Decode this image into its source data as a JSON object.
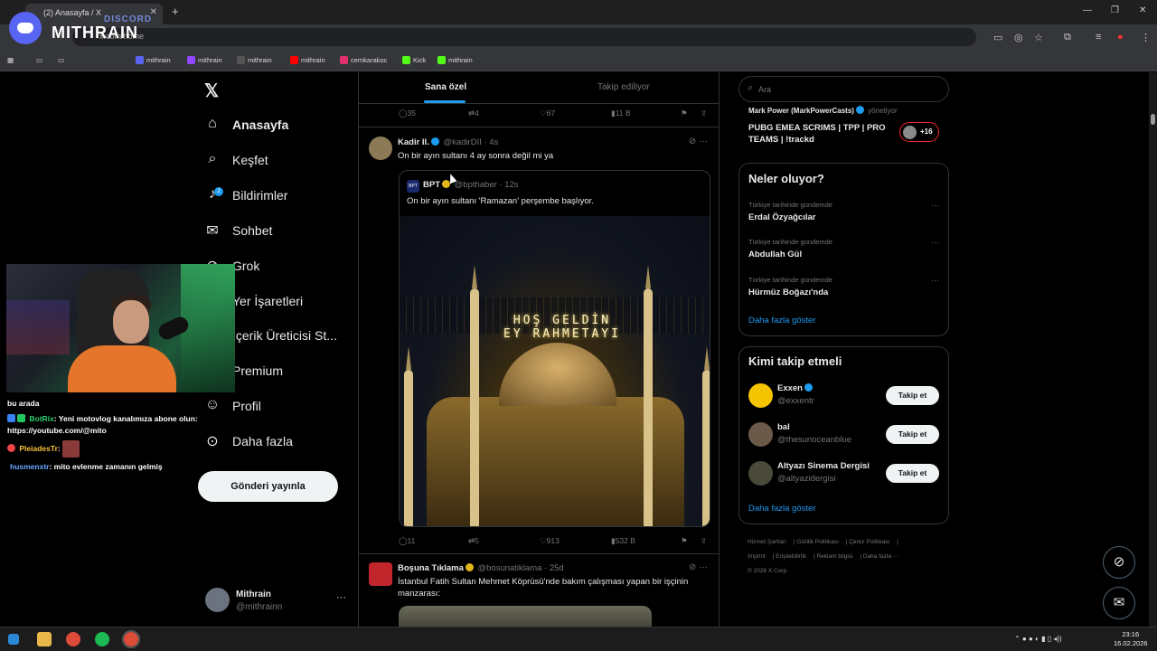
{
  "browser": {
    "tab_title": "(2) Anasayfa / X",
    "url": "x.com/home",
    "bookmarks": [
      {
        "label": "mithrain",
        "color": "#5865f2"
      },
      {
        "label": "mithrain",
        "color": "#9146ff"
      },
      {
        "label": "mithrain",
        "color": "#222222"
      },
      {
        "label": "mithrain",
        "color": "#ff0000"
      },
      {
        "label": "cemkarakoc",
        "color": "#e1306c"
      },
      {
        "label": "Kick",
        "color": "#53fc18"
      },
      {
        "label": "mithrain",
        "color": "#53fc18"
      }
    ]
  },
  "overlay": {
    "discord_label": "DISCORD",
    "channel_name": "MITHRAIN"
  },
  "chat": {
    "line0": "bu arada",
    "line1_user": "BotRix",
    "line1_text": ": Yeni motovlog kanalımıza abone olun: https://youtube.com/@mito",
    "line2_user": "PleiadesTr",
    "line2_text": ":",
    "line3_user": "husmenxtr",
    "line3_text": ": mito evlenme zamanın gelmiş"
  },
  "nav": {
    "logo": "𝕏",
    "items": [
      {
        "label": "Anasayfa",
        "icon": "home-icon"
      },
      {
        "label": "Keşfet",
        "icon": "search-icon"
      },
      {
        "label": "Bildirimler",
        "icon": "bell-icon"
      },
      {
        "label": "Sohbet",
        "icon": "mail-icon"
      },
      {
        "label": "Grok",
        "icon": "grok-icon"
      },
      {
        "label": "Yer İşaretleri",
        "icon": "bookmark-icon"
      },
      {
        "label": "İçerik Üreticisi St...",
        "icon": "creator-icon"
      },
      {
        "label": "Premium",
        "icon": "premium-icon"
      },
      {
        "label": "Profil",
        "icon": "user-icon"
      },
      {
        "label": "Daha fazla",
        "icon": "more-circle-icon"
      }
    ],
    "notification_count": "2",
    "post_button": "Gönderi yayınla"
  },
  "profile": {
    "name": "Mithrain",
    "handle": "@mithrainn",
    "more": "···"
  },
  "feed": {
    "tabs": [
      "Sana özel",
      "Takip ediliyor"
    ],
    "prev_post_actions": {
      "replies": "35",
      "reposts": "4",
      "likes": "67",
      "views": "11 B"
    },
    "post1": {
      "name": "Kadir II.",
      "meta": "@kadirDII · 4s",
      "text": "On bir ayın sultanı 4 ay sonra değil mi ya",
      "quote": {
        "avatar_text": "BPT",
        "name": "BPT",
        "meta": "@bpthaber · 12s",
        "text": "On bir ayın sultanı 'Ramazan' perşembe başlıyor.",
        "mahya_line1": "HOŞ GELDİN",
        "mahya_line2": "EY RAHMETAYI"
      },
      "actions": {
        "replies": "11",
        "reposts": "5",
        "likes": "913",
        "views": "532 B"
      }
    },
    "post2": {
      "name": "Boşuna Tıklama",
      "meta": "@bosunatiklama · 25d",
      "text": "İstanbul Fatih Sultan Mehmet Köprüsü'nde bakım çalışması yapan bir işçinin manzarası:"
    }
  },
  "sidebar": {
    "search_placeholder": "Ara",
    "space": {
      "host": "Mark Power (MarkPowerCasts)",
      "host_role": "yönetiyor",
      "title": "PUBG EMEA SCRIMS | TPP | PRO TEAMS | !trackd",
      "listeners": "+16"
    },
    "trends": {
      "title": "Neler oluyor?",
      "items": [
        {
          "context": "Türkiye tarihinde gündemde",
          "name": "Erdal Özyağcılar"
        },
        {
          "context": "Türkiye tarihinde gündemde",
          "name": "Abdullah Gül"
        },
        {
          "context": "Türkiye tarihinde gündemde",
          "name": "Hürmüz Boğazı'nda"
        }
      ],
      "show_more": "Daha fazla göster"
    },
    "who_to_follow": {
      "title": "Kimi takip etmeli",
      "items": [
        {
          "name": "Exxen",
          "handle": "@exxentr",
          "button": "Takip et"
        },
        {
          "name": "bal",
          "handle": "@thesunoceanblue",
          "button": "Takip et"
        },
        {
          "name": "Altyazı Sinema Dergisi",
          "handle": "@altyazidergisi",
          "button": "Takip et"
        }
      ],
      "show_more": "Daha fazla göster"
    },
    "footer": {
      "links": [
        "Hizmet Şartları",
        "Gizlilik Politikası",
        "Çerez Politikası",
        "Imprint",
        "Erişilebilirlik",
        "Reklam bilgisi",
        "Daha fazla ···"
      ],
      "copyright": "© 2026 X Corp."
    }
  },
  "taskbar": {
    "time": "23:16",
    "date": "16.02.2026"
  },
  "colors": {
    "accent": "#1d9bf0",
    "background": "#000000",
    "text": "#e7e9ea",
    "muted": "#71767b",
    "border": "#2f3336"
  }
}
